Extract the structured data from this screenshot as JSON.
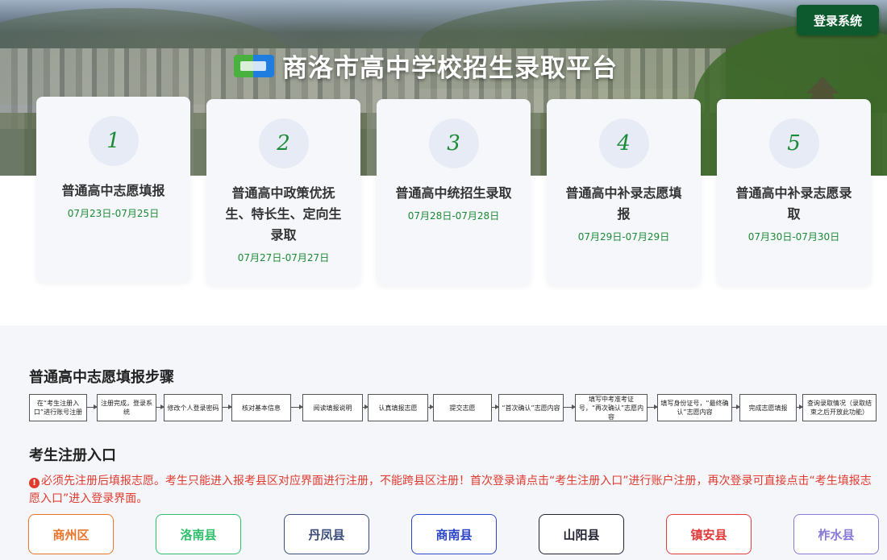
{
  "header": {
    "title": "商洛市高中学校招生录取平台",
    "login_label": "登录系统"
  },
  "stages": [
    {
      "num": "1",
      "name": "普通高中志愿填报",
      "date": "07月23日-07月25日"
    },
    {
      "num": "2",
      "name": "普通高中政策优抚生、特长生、定向生录取",
      "date": "07月27日-07月27日"
    },
    {
      "num": "3",
      "name": "普通高中统招生录取",
      "date": "07月28日-07月28日"
    },
    {
      "num": "4",
      "name": "普通高中补录志愿填报",
      "date": "07月29日-07月29日"
    },
    {
      "num": "5",
      "name": "普通高中补录志愿录取",
      "date": "07月30日-07月30日"
    }
  ],
  "steps_section": {
    "title": "普通高中志愿填报步骤",
    "steps": [
      "在“考生注册入口”进行账号注册",
      "注册完成，登录系统",
      "修改个人登录密码",
      "核对基本信息",
      "阅读填报说明",
      "认真填报志愿",
      "提交志愿",
      "“首次确认”志愿内容",
      "填写中考准考证号，“再次确认”志愿内容",
      "填写身份证号，“最终确认”志愿内容",
      "完成志愿填报",
      "查询录取情况（录取结束之后开放此功能）"
    ]
  },
  "registration": {
    "title": "考生注册入口",
    "notice_icon": "!",
    "notice": "必须先注册后填报志愿。考生只能进入报考县区对应界面进行注册，不能跨县区注册！首次登录请点击“考生注册入口”进行账户注册，再次登录可直接点击“考生填报志愿入口”进入登录界面。",
    "counties": [
      {
        "label": "商州区",
        "color": "#e8742a"
      },
      {
        "label": "洛南县",
        "color": "#2fbf6b"
      },
      {
        "label": "丹凤县",
        "color": "#3a4d7a"
      },
      {
        "label": "商南县",
        "color": "#2b45c8"
      },
      {
        "label": "山阳县",
        "color": "#222233"
      },
      {
        "label": "镇安县",
        "color": "#e03a3a"
      },
      {
        "label": "柞水县",
        "color": "#8a7ad6"
      }
    ]
  }
}
